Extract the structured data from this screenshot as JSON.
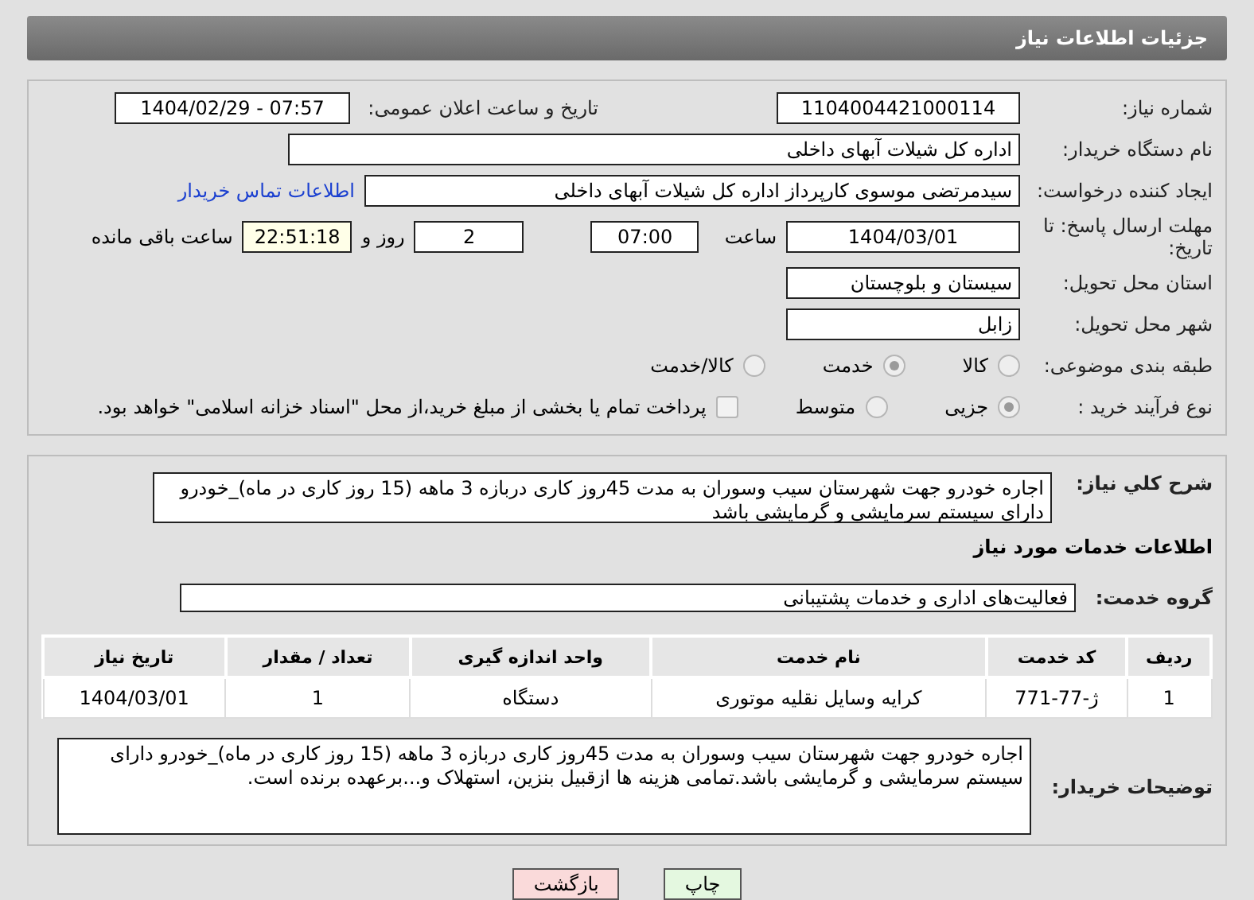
{
  "header": {
    "title": "جزئیات اطلاعات نیاز"
  },
  "need_number": {
    "label": "شماره نیاز:",
    "value": "1104004421000114"
  },
  "announce": {
    "label": "تاریخ و ساعت اعلان عمومی:",
    "value": "1404/02/29 - 07:57"
  },
  "buyer_org": {
    "label": "نام دستگاه خریدار:",
    "value": "اداره کل شیلات آبهای داخلی"
  },
  "requester": {
    "label": "ایجاد کننده درخواست:",
    "value": "سیدمرتضی موسوی کارپرداز اداره کل شیلات آبهای داخلی",
    "link": "اطلاعات تماس خریدار"
  },
  "deadline": {
    "label": "مهلت ارسال پاسخ: تا تاریخ:",
    "date": "1404/03/01",
    "time_label": "ساعت",
    "time": "07:00",
    "days": "2",
    "days_label": "روز و",
    "remaining": "22:51:18",
    "remaining_label": "ساعت باقی مانده"
  },
  "province": {
    "label": "استان محل تحویل:",
    "value": "سیستان و بلوچستان"
  },
  "city": {
    "label": "شهر محل تحویل:",
    "value": "زابل"
  },
  "category": {
    "label": "طبقه بندی موضوعی:",
    "options": [
      {
        "label": "کالا",
        "selected": false
      },
      {
        "label": "خدمت",
        "selected": true
      },
      {
        "label": "کالا/خدمت",
        "selected": false
      }
    ]
  },
  "process": {
    "label": "نوع فرآیند خرید :",
    "options": [
      {
        "label": "جزیی",
        "selected": true
      },
      {
        "label": "متوسط",
        "selected": false
      }
    ],
    "payment": {
      "checked": false,
      "text": "پرداخت تمام یا بخشی از مبلغ خرید،از محل \"اسناد خزانه اسلامی\" خواهد بود."
    }
  },
  "summary": {
    "label": "شرح کلي نیاز:",
    "value": "اجاره خودرو جهت شهرستان سیب وسوران به مدت 45روز کاری دربازه 3 ماهه (15 روز کاری در ماه)_خودرو دارای سیستم سرمایشی و گرمایشی باشد"
  },
  "services_heading": "اطلاعات خدمات مورد نیاز",
  "service_group": {
    "label": "گروه خدمت:",
    "value": "فعالیت‌های اداری و خدمات پشتیبانی"
  },
  "table": {
    "columns": [
      "ردیف",
      "کد خدمت",
      "نام خدمت",
      "واحد اندازه گیری",
      "تعداد / مقدار",
      "تاریخ نیاز"
    ],
    "rows": [
      [
        "1",
        "ژ-77-771",
        "کرایه وسایل نقلیه موتوری",
        "دستگاه",
        "1",
        "1404/03/01"
      ]
    ]
  },
  "buyer_notes": {
    "label": "توضیحات خریدار:",
    "value": "اجاره خودرو جهت شهرستان سیب وسوران به مدت 45روز کاری دربازه 3 ماهه (15 روز کاری در ماه)_خودرو دارای سیستم سرمایشی و گرمایشی باشد.تمامی هزینه ها ازقبیل بنزین، استهلاک و...برعهده برنده است."
  },
  "buttons": [
    {
      "label": "چاپ",
      "kind": "print"
    },
    {
      "label": "بازگشت",
      "kind": "back"
    }
  ]
}
